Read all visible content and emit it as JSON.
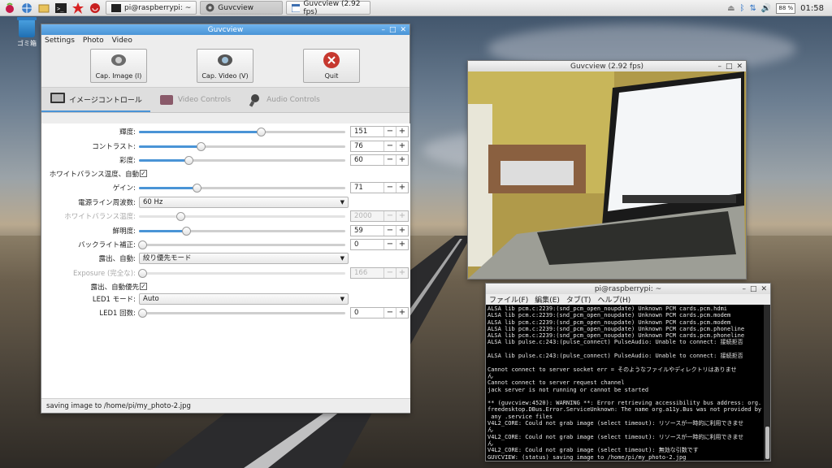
{
  "taskbar": {
    "tasks": [
      {
        "label": "pi@raspberrypi: ~"
      },
      {
        "label": "Guvcview"
      },
      {
        "label": "Guvcview  (2.92 fps)"
      }
    ],
    "cpu": "88 %",
    "clock": "01:58"
  },
  "desktop": {
    "trash_label": "ゴミ箱"
  },
  "guvc_main": {
    "title": "Guvcview",
    "menu": [
      "Settings",
      "Photo",
      "Video"
    ],
    "buttons": {
      "cap_image": "Cap. Image (I)",
      "cap_video": "Cap. Video (V)",
      "quit": "Quit"
    },
    "tabs": [
      "イメージコントロール",
      "Video Controls",
      "Audio Controls"
    ],
    "controls": [
      {
        "label": "輝度:",
        "kind": "slider",
        "value": "151",
        "level": 0.59,
        "disabled": false
      },
      {
        "label": "コントラスト:",
        "kind": "slider",
        "value": "76",
        "level": 0.3,
        "disabled": false
      },
      {
        "label": "彩度:",
        "kind": "slider",
        "value": "60",
        "level": 0.24,
        "disabled": false
      },
      {
        "label": "ホワイトバランス温度、自動:",
        "kind": "check",
        "checked": true
      },
      {
        "label": "ゲイン:",
        "kind": "slider",
        "value": "71",
        "level": 0.28,
        "disabled": false
      },
      {
        "label": "電源ライン周波数:",
        "kind": "combo",
        "value": "60 Hz"
      },
      {
        "label": "ホワイトバランス温度:",
        "kind": "slider",
        "value": "2000",
        "level": 0.2,
        "disabled": true
      },
      {
        "label": "鮮明度:",
        "kind": "slider",
        "value": "59",
        "level": 0.23,
        "disabled": false
      },
      {
        "label": "バックライト補正:",
        "kind": "slider",
        "value": "0",
        "level": 0.0,
        "disabled": false
      },
      {
        "label": "露出、自動:",
        "kind": "combo",
        "value": "絞り優先モード"
      },
      {
        "label": "Exposure (完全な):",
        "kind": "slider",
        "value": "166",
        "level": 0.0,
        "disabled": true
      },
      {
        "label": "露出、自動優先:",
        "kind": "check",
        "checked": true
      },
      {
        "label": "LED1 モード:",
        "kind": "combo",
        "value": "Auto"
      },
      {
        "label": "LED1 回数:",
        "kind": "slider",
        "value": "0",
        "level": 0.0,
        "disabled": false
      }
    ],
    "status": "saving image to /home/pi/my_photo-2.jpg"
  },
  "preview": {
    "title": "Guvcview  (2.92 fps)"
  },
  "terminal": {
    "title": "pi@raspberrypi: ~",
    "menu": [
      "ファイル(F)",
      "編集(E)",
      "タブ(T)",
      "ヘルプ(H)"
    ],
    "lines": [
      "ALSA lib pcm.c:2239:(snd_pcm_open_noupdate) Unknown PCM cards.pcm.hdmi",
      "ALSA lib pcm.c:2239:(snd_pcm_open_noupdate) Unknown PCM cards.pcm.modem",
      "ALSA lib pcm.c:2239:(snd_pcm_open_noupdate) Unknown PCM cards.pcm.modem",
      "ALSA lib pcm.c:2239:(snd_pcm_open_noupdate) Unknown PCM cards.pcm.phoneline",
      "ALSA lib pcm.c:2239:(snd_pcm_open_noupdate) Unknown PCM cards.pcm.phoneline",
      "ALSA lib pulse.c:243:(pulse_connect) PulseAudio: Unable to connect: 接続拒否",
      "",
      "ALSA lib pulse.c:243:(pulse_connect) PulseAudio: Unable to connect: 接続拒否",
      "",
      "Cannot connect to server socket err = そのようなファイルやディレクトリはありませ",
      "ん",
      "Cannot connect to server request channel",
      "jack server is not running or cannot be started",
      "",
      "** (guvcview:4520): WARNING **: Error retrieving accessibility bus address: org.",
      "freedesktop.DBus.Error.ServiceUnknown: The name org.a11y.Bus was not provided by",
      " any .service files",
      "V4L2_CORE: Could not grab image (select timeout): リソースが一時的に利用できませ",
      "ん",
      "V4L2_CORE: Could not grab image (select timeout): リソースが一時的に利用できませ",
      "ん",
      "V4L2_CORE: Could not grab image (select timeout): 無効な引数です",
      "GUVCVIEW: (status) saving image to /home/pi/my_photo-2.jpg",
      ""
    ]
  }
}
